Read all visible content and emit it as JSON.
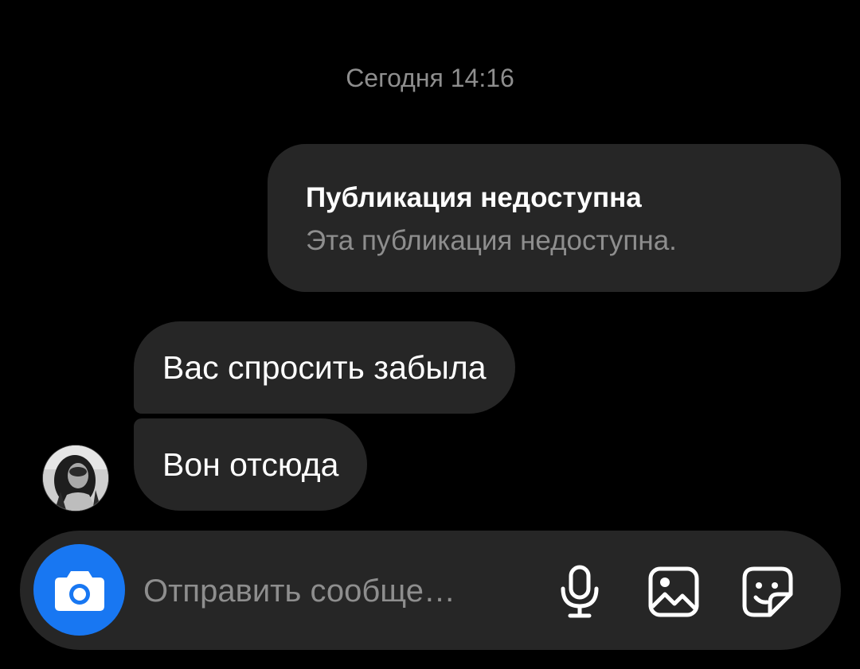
{
  "thread": {
    "timestamp": "Сегодня 14:16",
    "shared_post": {
      "title": "Публикация недоступна",
      "subtitle": "Эта публикация недоступна."
    },
    "incoming_messages": [
      {
        "text": "Вас спросить забыла"
      },
      {
        "text": "Вон отсюда"
      }
    ]
  },
  "composer": {
    "placeholder": "Отправить сообще…",
    "icons": {
      "camera": "camera-icon",
      "mic": "microphone-icon",
      "gallery": "image-icon",
      "sticker": "sticker-icon"
    },
    "accent_color": "#1877f2"
  },
  "colors": {
    "background": "#000000",
    "bubble": "#262626",
    "secondary_text": "#8e8e8e",
    "primary_text": "#ffffff"
  }
}
